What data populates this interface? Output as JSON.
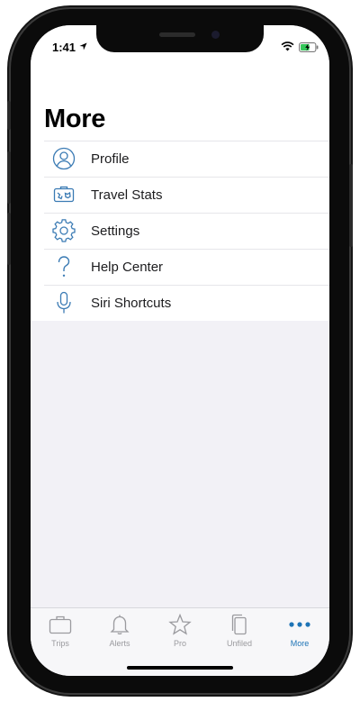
{
  "status_bar": {
    "time": "1:41"
  },
  "page": {
    "title": "More"
  },
  "menu": {
    "items": [
      {
        "label": "Profile",
        "icon": "profile-icon"
      },
      {
        "label": "Travel Stats",
        "icon": "travel-stats-icon"
      },
      {
        "label": "Settings",
        "icon": "gear-icon"
      },
      {
        "label": "Help Center",
        "icon": "question-icon"
      },
      {
        "label": "Siri Shortcuts",
        "icon": "microphone-icon"
      }
    ]
  },
  "tab_bar": {
    "active": "More",
    "tabs": [
      {
        "label": "Trips",
        "icon": "briefcase-icon"
      },
      {
        "label": "Alerts",
        "icon": "bell-icon"
      },
      {
        "label": "Pro",
        "icon": "star-icon"
      },
      {
        "label": "Unfiled",
        "icon": "documents-icon"
      },
      {
        "label": "More",
        "icon": "more-dots-icon"
      }
    ]
  },
  "colors": {
    "accent": "#1e74b6",
    "icon_blue": "#3b7bb4",
    "tab_inactive": "#9a9a9e",
    "background": "#f2f1f6"
  }
}
